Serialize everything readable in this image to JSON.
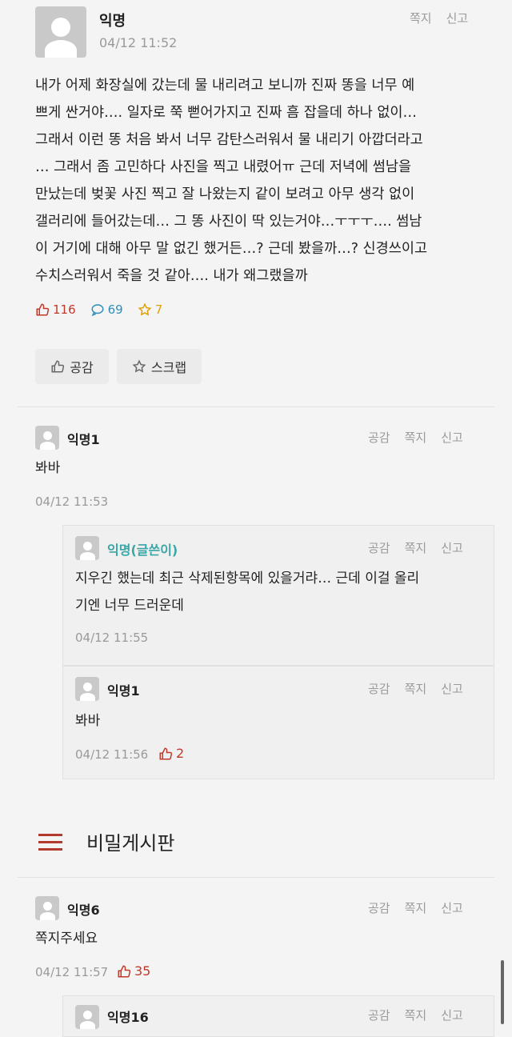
{
  "post": {
    "author": "익명",
    "time": "04/12 11:52",
    "actions": [
      "쪽지",
      "신고"
    ],
    "body_lines": [
      "내가 어제 화장실에 갔는데 물 내리려고 보니까 진짜 똥을 너무 예",
      "쁘게 싼거야…. 일자로 쭉 뻗어가지고 진짜 흠 잡을데 하나 없이…",
      "그래서 이런 똥 처음 봐서 너무 감탄스러워서 물 내리기 아깝더라고",
      "… 그래서 좀 고민하다 사진을 찍고 내렸어ㅠ 근데 저녁에 썸남을",
      "만났는데 벚꽃 사진 찍고 잘 나왔는지 같이 보려고 아무 생각 없이",
      "갤러리에 들어갔는데… 그 똥 사진이 딱 있는거야…ㅜㅜㅜ…. 썸남",
      "이 거기에 대해 아무 말 없긴 했거든…? 근데 봤을까…? 신경쓰이고",
      "수치스러워서 죽을 것 같아…. 내가 왜그랬을까"
    ],
    "likes": "116",
    "comments": "69",
    "scraps": "7",
    "like_button": "공감",
    "scrap_button": "스크랩"
  },
  "comments": [
    {
      "author": "익명1",
      "text": "봐바",
      "time": "04/12 11:53",
      "actions": [
        "공감",
        "쪽지",
        "신고"
      ]
    },
    {
      "author": "익명(글쓴이)",
      "text_lines": [
        "지우긴 했는데 최근 삭제된항목에 있을거랴… 근데 이걸 올리",
        "기엔 너무 드러운데"
      ],
      "time": "04/12 11:55",
      "actions": [
        "공감",
        "쪽지",
        "신고"
      ]
    },
    {
      "author": "익명1",
      "text": "봐바",
      "time": "04/12 11:56",
      "likes": "2",
      "actions": [
        "공감",
        "쪽지",
        "신고"
      ]
    }
  ],
  "board": {
    "title": "비밀게시판"
  },
  "board_comments": [
    {
      "author": "익명6",
      "text": "쪽지주세요",
      "time": "04/12 11:57",
      "likes": "35",
      "actions": [
        "공감",
        "쪽지",
        "신고"
      ]
    },
    {
      "author": "익명16",
      "actions": [
        "공감",
        "쪽지",
        "신고"
      ]
    }
  ],
  "colors": {
    "like": "#c0392b",
    "comment": "#2f8fb5",
    "scrap": "#e0a000",
    "author_highlight": "#3aa6a6",
    "menu_icon": "#b23a2e"
  }
}
